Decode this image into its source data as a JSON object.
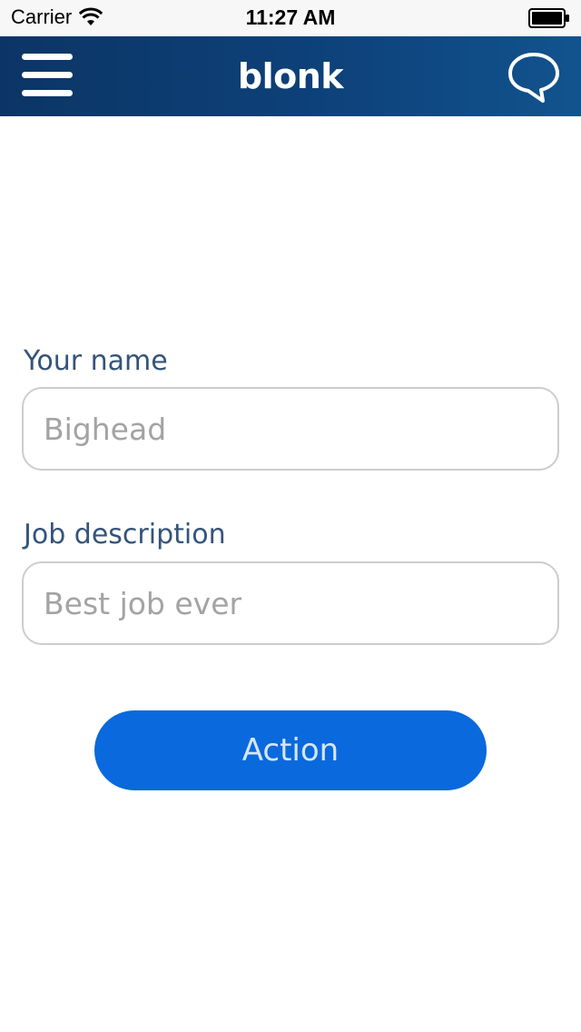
{
  "status_bar": {
    "carrier": "Carrier",
    "time": "11:27 AM"
  },
  "nav": {
    "brand": "blonk",
    "left_icon": "menu-icon",
    "right_icon": "chat-bubble-icon",
    "colors": {
      "bar_start": "#0c3566",
      "bar_end": "#12538e"
    }
  },
  "form": {
    "name_label": "Your name",
    "name_placeholder": "Bighead",
    "job_label": "Job description",
    "job_placeholder": "Best job ever",
    "action_label": "Action",
    "colors": {
      "label": "#34547a",
      "button": "#0a69dc"
    }
  }
}
